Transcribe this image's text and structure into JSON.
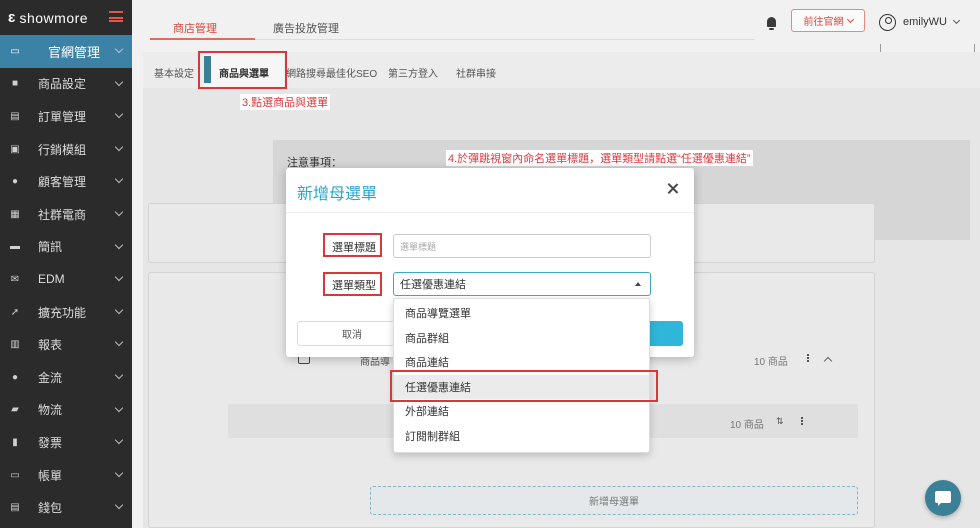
{
  "app": {
    "brand": "showmore"
  },
  "sidebar": {
    "items": [
      {
        "label": "官網管理",
        "icon": "laptop-icon",
        "active": true
      },
      {
        "label": "商品設定",
        "icon": "cube-icon"
      },
      {
        "label": "訂單管理",
        "icon": "document-icon"
      },
      {
        "label": "行銷模組",
        "icon": "gift-icon"
      },
      {
        "label": "顧客管理",
        "icon": "user-icon"
      },
      {
        "label": "社群電商",
        "icon": "tv-icon"
      },
      {
        "label": "簡訊",
        "icon": "message-icon"
      },
      {
        "label": "EDM",
        "icon": "envelope-icon"
      },
      {
        "label": "擴充功能",
        "icon": "rocket-icon"
      },
      {
        "label": "報表",
        "icon": "bar-chart-icon"
      },
      {
        "label": "金流",
        "icon": "money-bag-icon"
      },
      {
        "label": "物流",
        "icon": "truck-icon"
      },
      {
        "label": "發票",
        "icon": "receipt-icon"
      },
      {
        "label": "帳單",
        "icon": "credit-card-icon"
      },
      {
        "label": "錢包",
        "icon": "wallet-icon"
      }
    ]
  },
  "header": {
    "tabs": [
      "商店管理",
      "廣告投放管理"
    ],
    "front_button": "前往官網",
    "user_name": "emilyWU"
  },
  "subtabs": [
    "基本設定",
    "商品與選單",
    "網路搜尋最佳化SEO",
    "第三方登入",
    "社群串接"
  ],
  "notice_title": "注意事項：",
  "annotations": {
    "step3": "3.點選商品與選單",
    "step4": "4.於彈跳視窗內命名選單標題，選單類型請點選“任選優惠連結”"
  },
  "background_rows": {
    "row_label": "商品導",
    "count1": "10 商品",
    "count2": "10 商品",
    "add_parent": "新增母選單"
  },
  "modal": {
    "title": "新增母選單",
    "title_label": "選單標題",
    "title_placeholder": "選單標題",
    "type_label": "選單類型",
    "type_value": "任選優惠連結",
    "cancel": "取消"
  },
  "dropdown": {
    "options": [
      "商品導覽選單",
      "商品群組",
      "商品連結",
      "任選優惠連結",
      "外部連結",
      "訂閱制群組"
    ],
    "selected_index": 3
  },
  "colors": {
    "accent": "#2aa6cc",
    "brand_red": "#d9473c",
    "sidebar": "#2b2b2b",
    "active_nav": "#3c82a6"
  }
}
